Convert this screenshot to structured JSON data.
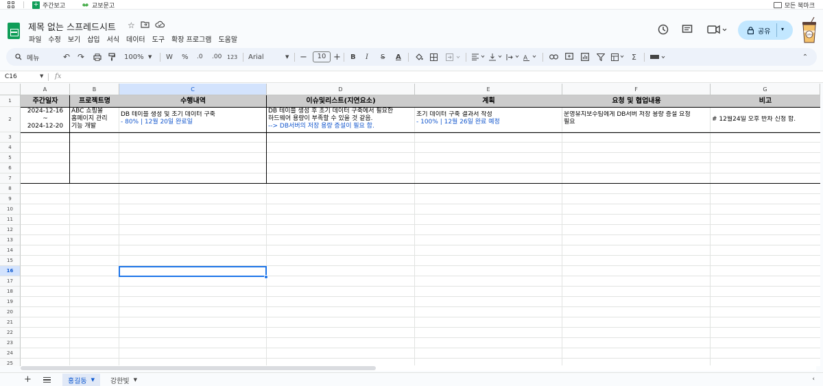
{
  "bookmarks": {
    "items": [
      {
        "label": "주간보고"
      },
      {
        "label": "교보문고"
      }
    ],
    "all_bookmarks": "모든 북마크"
  },
  "document": {
    "title": "제목 없는 스프레드시트"
  },
  "menu": [
    "파일",
    "수정",
    "보기",
    "삽입",
    "서식",
    "데이터",
    "도구",
    "확장 프로그램",
    "도움말"
  ],
  "share": {
    "label": "공유"
  },
  "avatar": {
    "label": "Coffee"
  },
  "toolbar": {
    "search_label": "메뉴",
    "zoom": "100%",
    "currency": "W",
    "percent": "%",
    "decimal_decrease": ".0",
    "decimal_increase": ".00",
    "number_format": "123",
    "font": "Arial",
    "font_size": "10",
    "bold": "B",
    "italic": "I",
    "strike": "S",
    "text_color": "A",
    "sum": "Σ"
  },
  "formula_bar": {
    "cell_ref": "C16",
    "fx": "fx"
  },
  "columns": [
    "A",
    "B",
    "C",
    "D",
    "E",
    "F",
    "G"
  ],
  "rows": [
    "1",
    "2",
    "3",
    "4",
    "5",
    "6",
    "7",
    "8",
    "9",
    "10",
    "11",
    "12",
    "13",
    "14",
    "15",
    "16",
    "17",
    "18",
    "19",
    "20",
    "21",
    "22",
    "23",
    "24",
    "25"
  ],
  "table": {
    "headers": [
      "주간일자",
      "프로젝트명",
      "수행내역",
      "이슈및리스트(지연요소)",
      "계획",
      "요청 및 협업내용",
      "비고"
    ],
    "row2": {
      "a": [
        "2024-12-16",
        "~",
        "2024-12-20"
      ],
      "b": [
        "ABC 쇼핑몰",
        "홈페이지 관리",
        "기능 개발"
      ],
      "c": [
        "DB 테이블 생성 및 초기 데이터 구축",
        " - 80%  |  12월 20일 완료일"
      ],
      "d": [
        "DB 테이블 생성 후 초기 데이터 구축에서 필요한",
        "하드웨어 용량이 부족할 수 있을 것 같음.",
        " --> DB서버의 저장 용량 증설이 필요 함."
      ],
      "e": [
        "초기 데이터 구축 결과서 작성",
        " - 100% | 12월 26일 완료 예정"
      ],
      "f": [
        "운영유지보수팀에게 DB서버 저장 용량 증설 요청",
        "필요"
      ],
      "g": [
        "# 12월24일 오후 반차 신청 함."
      ]
    }
  },
  "sheets": [
    {
      "label": "홍길동",
      "active": true
    },
    {
      "label": "강한빛",
      "active": false
    }
  ],
  "colors": {
    "accent": "#1a73e8",
    "sheets_green": "#0f9d58",
    "header_fill": "#cccccc",
    "share_bg": "#c2e7ff",
    "link_blue": "#1155cc"
  }
}
